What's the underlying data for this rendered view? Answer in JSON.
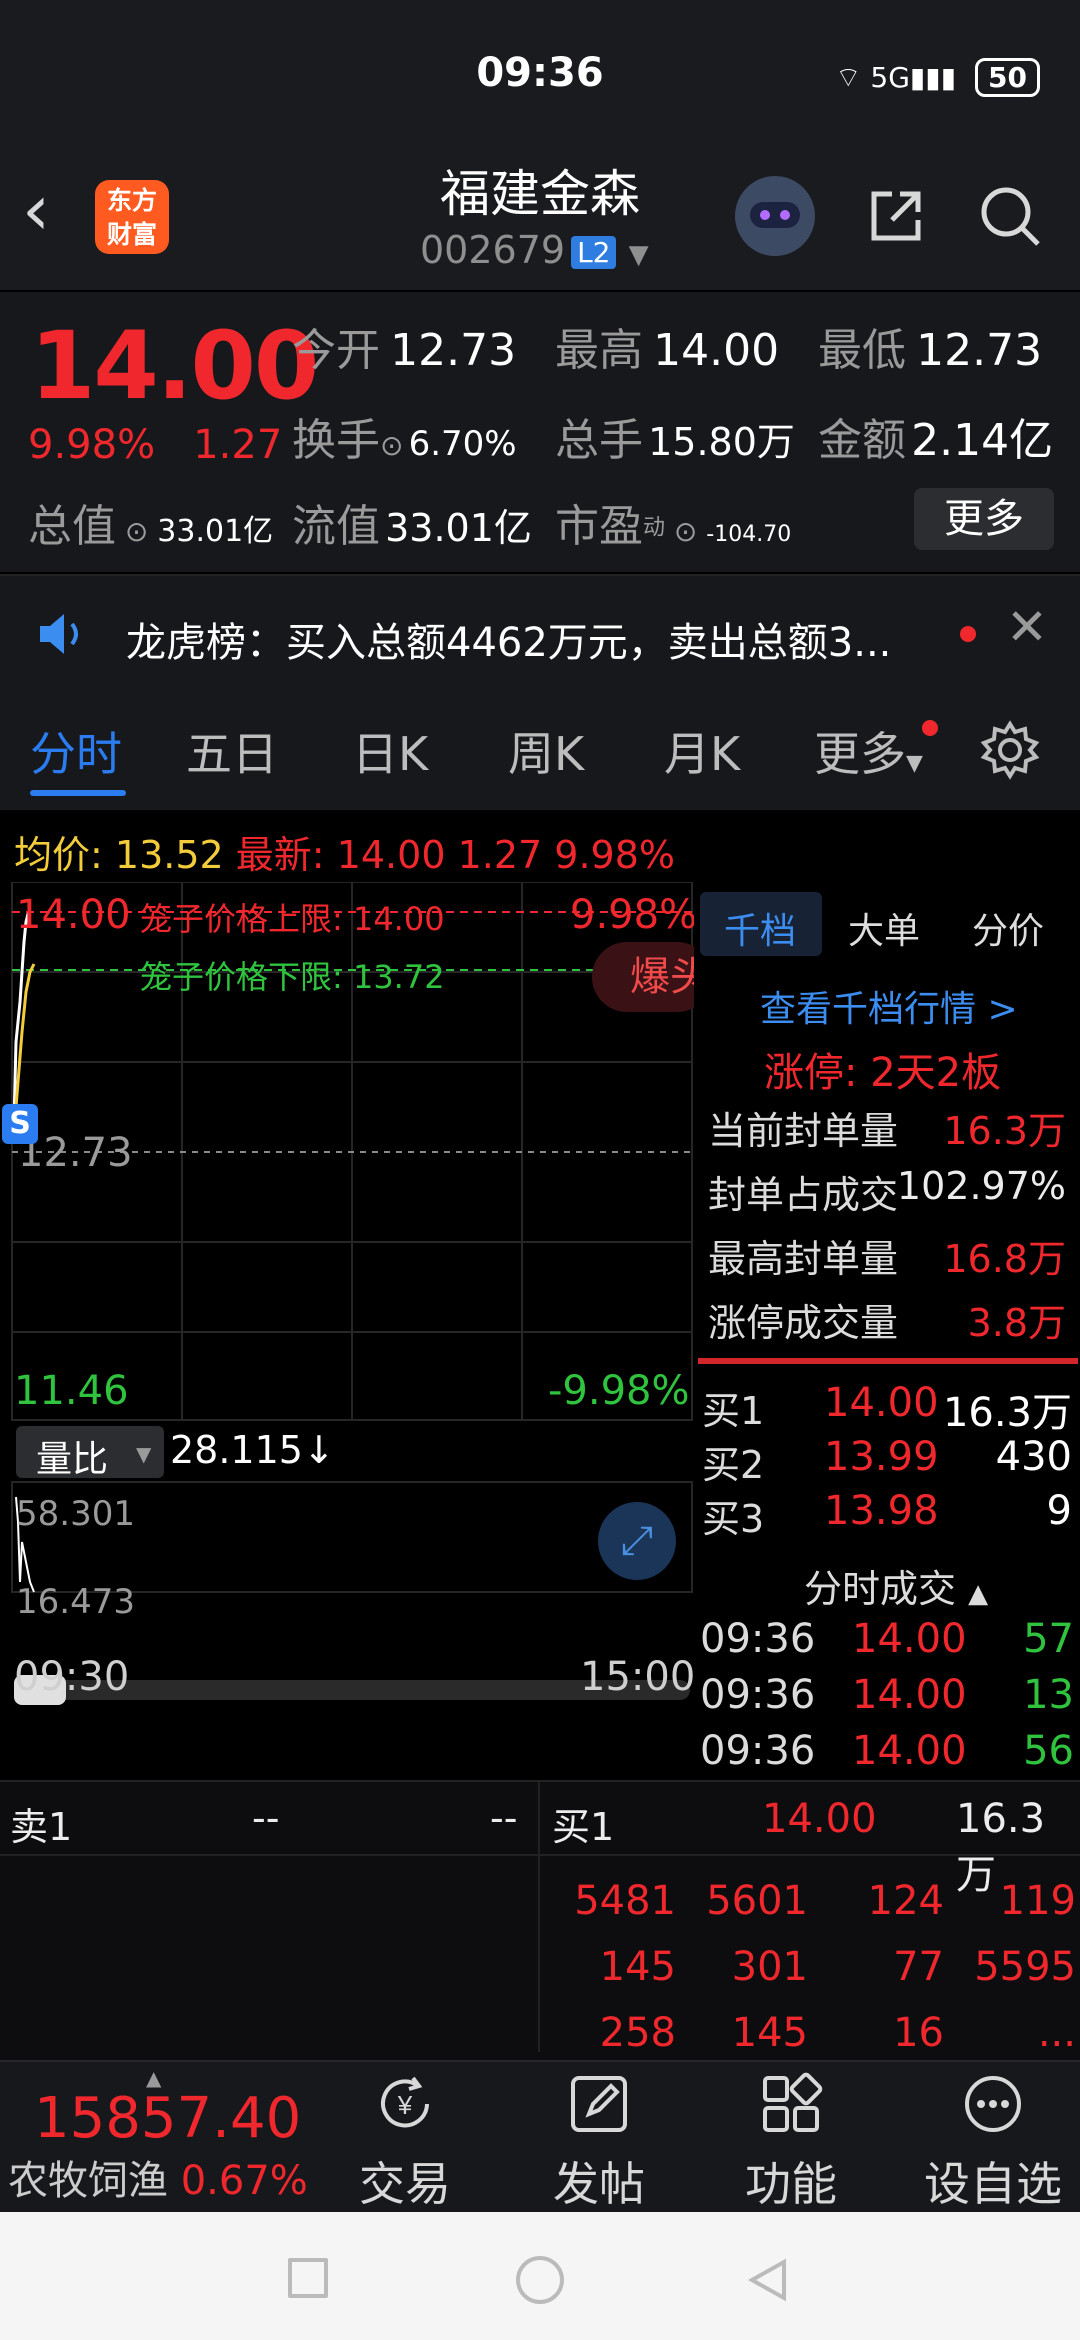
{
  "status": {
    "time": "09:36",
    "network": "5G",
    "battery": "50"
  },
  "header": {
    "logo_line1": "东方",
    "logo_line2": "财富",
    "stock_name": "福建金森",
    "stock_code": "002679",
    "level_badge": "L2"
  },
  "quote": {
    "price": "14.00",
    "change_pct": "9.98%",
    "change": "1.27",
    "open_label": "今开",
    "open": "12.73",
    "high_label": "最高",
    "high": "14.00",
    "low_label": "最低",
    "low": "12.73",
    "turnover_label": "换手",
    "turnover": "6.70%",
    "volume_label": "总手",
    "volume": "15.80万",
    "amount_label": "金额",
    "amount": "2.14亿",
    "total_value_label": "总值",
    "total_value": "33.01亿",
    "float_value_label": "流值",
    "float_value": "33.01亿",
    "pe_label": "市盈",
    "pe_super": "动",
    "pe": "-104.70",
    "more_button": "更多"
  },
  "news": {
    "text": "龙虎榜：买入总额4462万元，卖出总额3..."
  },
  "tabs": [
    "分时",
    "五日",
    "日K",
    "周K",
    "月K",
    "更多"
  ],
  "chart": {
    "avg_label": "均价:",
    "avg_value": "13.52",
    "latest_label": "最新:",
    "latest_value": "14.00",
    "latest_change": "1.27",
    "latest_pct": "9.98%",
    "upper_price": "14.00",
    "upper_pct": "9.98%",
    "cage_upper": "笼子价格上限: 14.00",
    "cage_lower": "笼子价格下限: 13.72",
    "burst_label": "爆头",
    "mid_price": "12.73",
    "lower_price": "11.46",
    "lower_pct": "-9.98%",
    "marker": "S",
    "volume_ratio_label": "量比",
    "volume_ratio_value": "28.115↓",
    "vr_high": "58.301",
    "vr_low": "16.473",
    "time_start": "09:30",
    "time_end": "15:00",
    "colors": {
      "price_line": "#ffffff",
      "avg_line": "#f2cc3a",
      "cage_upper": "#f0282d",
      "cage_lower": "#2fc33e"
    }
  },
  "right_panel": {
    "tabs": [
      "千档",
      "大单",
      "分价"
    ],
    "link": "查看千档行情 >",
    "limit_title": "涨停: 2天2板",
    "rows": [
      {
        "label": "当前封单量",
        "value": "16.3万"
      },
      {
        "label": "封单占成交",
        "value": "102.97%"
      },
      {
        "label": "最高封单量",
        "value": "16.8万"
      },
      {
        "label": "涨停成交量",
        "value": "3.8万"
      }
    ],
    "buys": [
      {
        "label": "买1",
        "price": "14.00",
        "vol": "16.3万"
      },
      {
        "label": "买2",
        "price": "13.99",
        "vol": "430"
      },
      {
        "label": "买3",
        "price": "13.98",
        "vol": "9"
      }
    ],
    "trades_title": "分时成交",
    "trades": [
      {
        "time": "09:36",
        "price": "14.00",
        "vol": "57"
      },
      {
        "time": "09:36",
        "price": "14.00",
        "vol": "13"
      },
      {
        "time": "09:36",
        "price": "14.00",
        "vol": "56"
      }
    ]
  },
  "order_book": {
    "sell1_label": "卖1",
    "sell1_price": "--",
    "sell1_vol": "--",
    "buy1_label": "买1",
    "buy1_price": "14.00",
    "buy1_vol": "16.3万",
    "queue": [
      [
        "5481",
        "5601",
        "124",
        "119"
      ],
      [
        "145",
        "301",
        "77",
        "5595"
      ],
      [
        "258",
        "145",
        "16",
        "..."
      ]
    ]
  },
  "bottom_nav": {
    "index_value": "15857.40",
    "index_name": "农牧饲渔",
    "index_pct": "0.67%",
    "items": [
      "交易",
      "发帖",
      "功能",
      "设自选"
    ]
  }
}
